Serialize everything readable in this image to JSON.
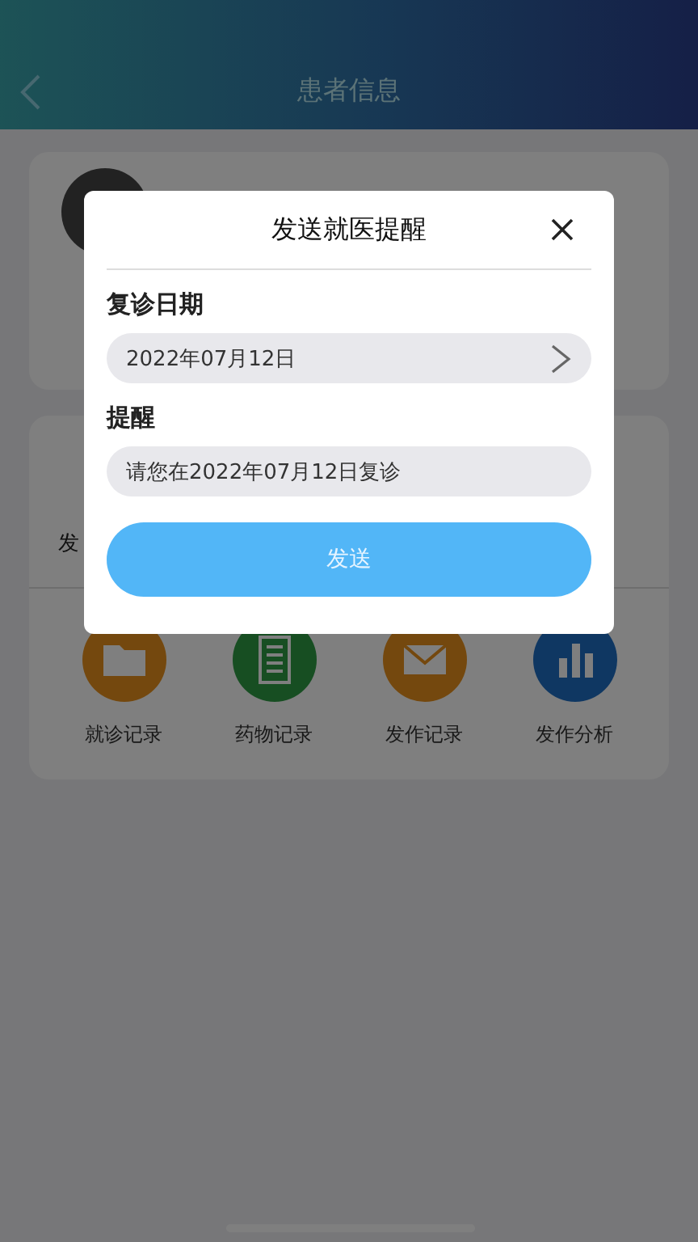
{
  "header": {
    "title": "患者信息"
  },
  "actions_card": {
    "partial_label": "发"
  },
  "features": [
    {
      "label": "就诊记录",
      "kind": "folder"
    },
    {
      "label": "药物记录",
      "kind": "notepad"
    },
    {
      "label": "发作记录",
      "kind": "mail"
    },
    {
      "label": "发作分析",
      "kind": "chart"
    }
  ],
  "dialog": {
    "title": "发送就医提醒",
    "fields": [
      {
        "label": "复诊日期",
        "value": "2022年07月12日",
        "kind": "picker"
      },
      {
        "label": "提醒",
        "value": "请您在2022年07月12日复诊",
        "kind": "text"
      }
    ],
    "button": "发送"
  }
}
